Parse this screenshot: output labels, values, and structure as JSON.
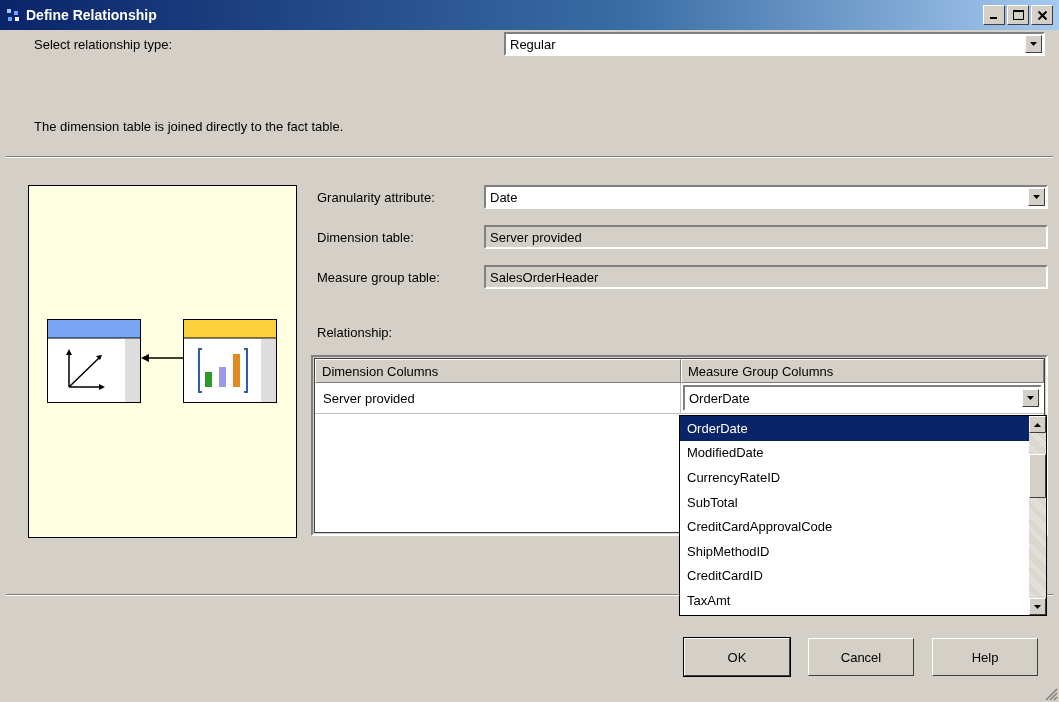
{
  "window": {
    "title": "Define Relationship"
  },
  "relationship_type": {
    "label": "Select relationship type:",
    "value": "Regular"
  },
  "description": "The dimension table is joined directly to the fact table.",
  "fields": [
    {
      "kind": "combo",
      "label": "Granularity attribute:",
      "value": "Date"
    },
    {
      "kind": "readonly",
      "label": "Dimension table:",
      "value": "Server provided"
    },
    {
      "kind": "readonly",
      "label": "Measure group table:",
      "value": "SalesOrderHeader"
    }
  ],
  "relationship": {
    "label": "Relationship:",
    "columns": [
      "Dimension Columns",
      "Measure Group Columns"
    ],
    "rows": [
      {
        "dimension": "Server provided",
        "measure": "OrderDate"
      }
    ],
    "dropdown": [
      {
        "text": "OrderDate",
        "selected": true
      },
      {
        "text": "ModifiedDate",
        "selected": false
      },
      {
        "text": "CurrencyRateID",
        "selected": false
      },
      {
        "text": "SubTotal",
        "selected": false
      },
      {
        "text": "CreditCardApprovalCode",
        "selected": false
      },
      {
        "text": "ShipMethodID",
        "selected": false
      },
      {
        "text": "CreditCardID",
        "selected": false
      },
      {
        "text": "TaxAmt",
        "selected": false
      }
    ]
  },
  "buttons": [
    {
      "label": "OK",
      "default": true
    },
    {
      "label": "Cancel",
      "default": false
    },
    {
      "label": "Help",
      "default": false
    }
  ]
}
